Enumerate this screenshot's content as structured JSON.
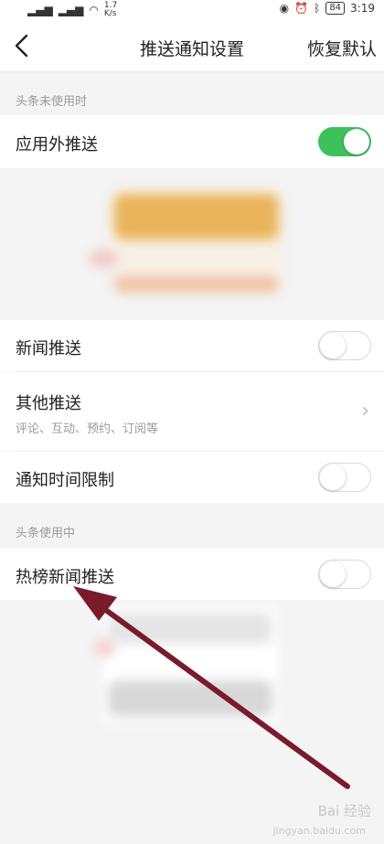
{
  "status_bar": {
    "net_speed": "1.7\nK/s",
    "battery": "84",
    "time": "3:19"
  },
  "nav": {
    "title": "推送通知设置",
    "restore_label": "恢复默认"
  },
  "sections": {
    "not_using": "头条未使用时",
    "using": "头条使用中"
  },
  "rows": {
    "outside_push": {
      "label": "应用外推送",
      "toggle": "on"
    },
    "news_push": {
      "label": "新闻推送",
      "toggle": "off"
    },
    "other_push": {
      "label": "其他推送",
      "sub": "评论、互动、预约、订阅等"
    },
    "time_limit": {
      "label": "通知时间限制",
      "toggle": "off"
    },
    "hot_news_push": {
      "label": "热榜新闻推送",
      "toggle": "off"
    }
  },
  "watermark": {
    "brand": "Bai 经验",
    "url": "jingyan.baidu.com"
  },
  "colors": {
    "toggle_on": "#3cc15d",
    "arrow": "#7a1b2c"
  }
}
